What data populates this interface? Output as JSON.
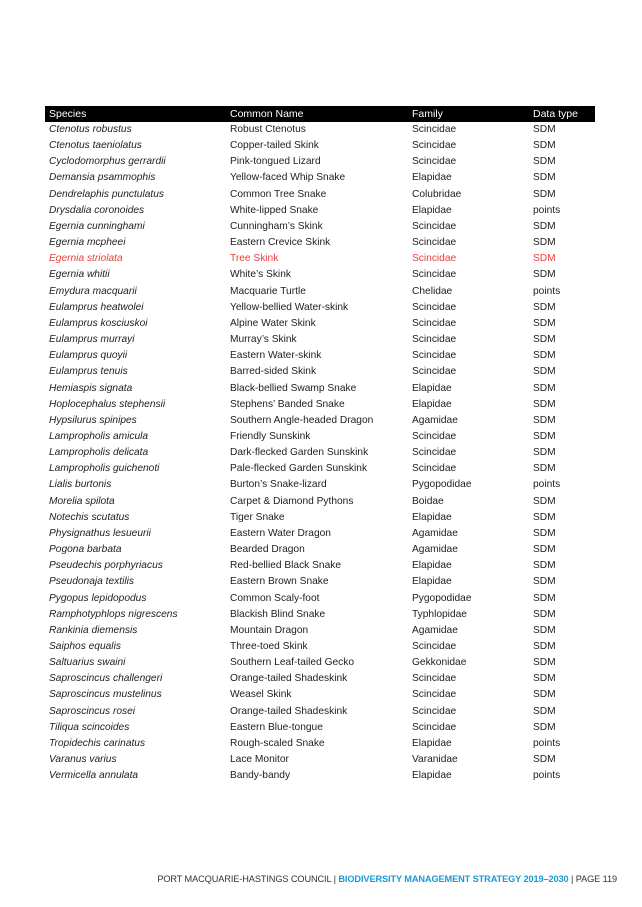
{
  "table": {
    "headers": [
      "Species",
      "Common Name",
      "Family",
      "Data type"
    ],
    "highlight_color": "#e8423c",
    "rows": [
      {
        "species": "Ctenotus robustus",
        "common": "Robust Ctenotus",
        "family": "Scincidae",
        "type": "SDM"
      },
      {
        "species": "Ctenotus taeniolatus",
        "common": "Copper-tailed Skink",
        "family": "Scincidae",
        "type": "SDM"
      },
      {
        "species": "Cyclodomorphus gerrardii",
        "common": "Pink-tongued Lizard",
        "family": "Scincidae",
        "type": "SDM"
      },
      {
        "species": "Demansia psammophis",
        "common": "Yellow-faced Whip Snake",
        "family": "Elapidae",
        "type": "SDM"
      },
      {
        "species": "Dendrelaphis punctulatus",
        "common": "Common Tree Snake",
        "family": "Colubridae",
        "type": "SDM"
      },
      {
        "species": "Drysdalia coronoides",
        "common": "White-lipped Snake",
        "family": "Elapidae",
        "type": "points"
      },
      {
        "species": "Egernia cunninghami",
        "common": "Cunningham’s Skink",
        "family": "Scincidae",
        "type": "SDM"
      },
      {
        "species": "Egernia mcpheei",
        "common": "Eastern Crevice Skink",
        "family": "Scincidae",
        "type": "SDM"
      },
      {
        "species": "Egernia striolata",
        "common": "Tree Skink",
        "family": "Scincidae",
        "type": "SDM",
        "highlighted": true
      },
      {
        "species": "Egernia whitii",
        "common": "White’s Skink",
        "family": "Scincidae",
        "type": "SDM"
      },
      {
        "species": "Emydura macquarii",
        "common": "Macquarie Turtle",
        "family": "Chelidae",
        "type": "points"
      },
      {
        "species": "Eulamprus heatwolei",
        "common": "Yellow-bellied Water-skink",
        "family": "Scincidae",
        "type": "SDM"
      },
      {
        "species": "Eulamprus kosciuskoi",
        "common": "Alpine Water Skink",
        "family": "Scincidae",
        "type": "SDM"
      },
      {
        "species": "Eulamprus murrayi",
        "common": "Murray’s Skink",
        "family": "Scincidae",
        "type": "SDM"
      },
      {
        "species": "Eulamprus quoyii",
        "common": "Eastern Water-skink",
        "family": "Scincidae",
        "type": "SDM"
      },
      {
        "species": "Eulamprus tenuis",
        "common": "Barred-sided Skink",
        "family": "Scincidae",
        "type": "SDM"
      },
      {
        "species": "Hemiaspis signata",
        "common": "Black-bellied Swamp Snake",
        "family": "Elapidae",
        "type": "SDM"
      },
      {
        "species": "Hoplocephalus stephensii",
        "common": "Stephens’ Banded Snake",
        "family": "Elapidae",
        "type": "SDM"
      },
      {
        "species": "Hypsilurus spinipes",
        "common": "Southern Angle-headed Dragon",
        "family": "Agamidae",
        "type": "SDM"
      },
      {
        "species": "Lampropholis amicula",
        "common": "Friendly Sunskink",
        "family": "Scincidae",
        "type": "SDM"
      },
      {
        "species": "Lampropholis delicata",
        "common": "Dark-flecked Garden Sunskink",
        "family": "Scincidae",
        "type": "SDM"
      },
      {
        "species": "Lampropholis guichenoti",
        "common": "Pale-flecked Garden Sunskink",
        "family": "Scincidae",
        "type": "SDM"
      },
      {
        "species": "Lialis burtonis",
        "common": "Burton’s Snake-lizard",
        "family": "Pygopodidae",
        "type": "points"
      },
      {
        "species": "Morelia spilota",
        "common": "Carpet & Diamond Pythons",
        "family": "Boidae",
        "type": "SDM"
      },
      {
        "species": "Notechis scutatus",
        "common": "Tiger Snake",
        "family": "Elapidae",
        "type": "SDM"
      },
      {
        "species": "Physignathus lesueurii",
        "common": "Eastern Water Dragon",
        "family": "Agamidae",
        "type": "SDM"
      },
      {
        "species": "Pogona barbata",
        "common": "Bearded Dragon",
        "family": "Agamidae",
        "type": "SDM"
      },
      {
        "species": "Pseudechis porphyriacus",
        "common": "Red-bellied Black Snake",
        "family": "Elapidae",
        "type": "SDM"
      },
      {
        "species": "Pseudonaja textilis",
        "common": "Eastern Brown Snake",
        "family": "Elapidae",
        "type": "SDM"
      },
      {
        "species": "Pygopus lepidopodus",
        "common": "Common Scaly-foot",
        "family": "Pygopodidae",
        "type": "SDM"
      },
      {
        "species": "Ramphotyphlops nigrescens",
        "common": "Blackish Blind Snake",
        "family": "Typhlopidae",
        "type": "SDM"
      },
      {
        "species": "Rankinia diemensis",
        "common": "Mountain Dragon",
        "family": "Agamidae",
        "type": "SDM"
      },
      {
        "species": "Saiphos equalis",
        "common": "Three-toed Skink",
        "family": "Scincidae",
        "type": "SDM"
      },
      {
        "species": "Saltuarius swaini",
        "common": "Southern Leaf-tailed Gecko",
        "family": "Gekkonidae",
        "type": "SDM"
      },
      {
        "species": "Saproscincus challengeri",
        "common": "Orange-tailed Shadeskink",
        "family": "Scincidae",
        "type": "SDM"
      },
      {
        "species": "Saproscincus mustelinus",
        "common": "Weasel Skink",
        "family": "Scincidae",
        "type": "SDM"
      },
      {
        "species": "Saproscincus rosei",
        "common": "Orange-tailed Shadeskink",
        "family": "Scincidae",
        "type": "SDM"
      },
      {
        "species": "Tiliqua scincoides",
        "common": "Eastern Blue-tongue",
        "family": "Scincidae",
        "type": "SDM"
      },
      {
        "species": "Tropidechis carinatus",
        "common": "Rough-scaled Snake",
        "family": "Elapidae",
        "type": "points"
      },
      {
        "species": "Varanus varius",
        "common": "Lace Monitor",
        "family": "Varanidae",
        "type": "SDM"
      },
      {
        "species": "Vermicella annulata",
        "common": "Bandy-bandy",
        "family": "Elapidae",
        "type": "points"
      }
    ]
  },
  "footer": {
    "organization": "PORT MACQUARIE-HASTINGS COUNCIL",
    "separator": " | ",
    "document_title": "BIODIVERSITY MANAGEMENT STRATEGY 2019–2030",
    "page_label": "PAGE 119",
    "accent_color": "#1a9ad6"
  }
}
